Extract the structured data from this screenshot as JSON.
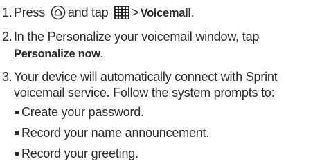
{
  "steps": [
    {
      "number": "1.",
      "prefix": "Press",
      "home_icon": "home-button-icon",
      "middle": "and tap",
      "apps_icon": "apps-grid-icon",
      "arrow": ">",
      "target": "Voicemail",
      "suffix": "."
    },
    {
      "number": "2.",
      "line1": "In the Personalize your voicemail window, tap",
      "target": "Personalize now",
      "suffix": "."
    },
    {
      "number": "3.",
      "line1": "Your device will automatically connect with Sprint",
      "line2": "voicemail service. Follow the system prompts to:"
    }
  ],
  "bullets": [
    "Create your password.",
    "Record your name announcement.",
    "Record your greeting."
  ],
  "colors": {
    "text": "#2a2a2a"
  }
}
